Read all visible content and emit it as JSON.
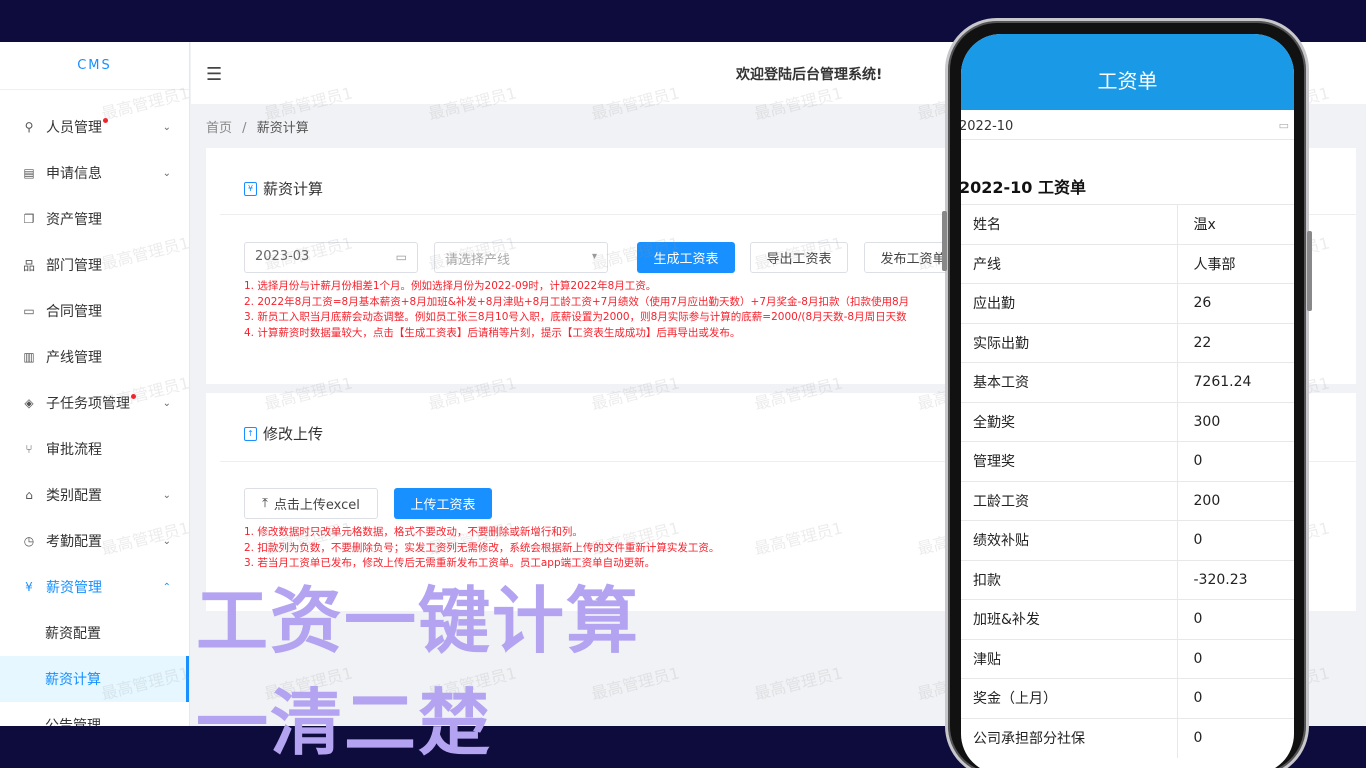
{
  "app": {
    "logo": "CMS",
    "welcome": "欢迎登陆后台管理系统!",
    "watermark": "最高管理员1"
  },
  "sidebar": {
    "items": [
      {
        "label": "人员管理",
        "icon": "user-icon",
        "glyph": "⚲",
        "dot": true,
        "chevron": "﹀"
      },
      {
        "label": "申请信息",
        "icon": "document-icon",
        "glyph": "▤",
        "dot": false,
        "chevron": "﹀"
      },
      {
        "label": "资产管理",
        "icon": "copy-icon",
        "glyph": "❐",
        "dot": false,
        "chevron": ""
      },
      {
        "label": "部门管理",
        "icon": "org-chart-icon",
        "glyph": "品",
        "dot": false,
        "chevron": ""
      },
      {
        "label": "合同管理",
        "icon": "folder-icon",
        "glyph": "▭",
        "dot": false,
        "chevron": ""
      },
      {
        "label": "产线管理",
        "icon": "pillar-icon",
        "glyph": "▥",
        "dot": false,
        "chevron": ""
      },
      {
        "label": "子任务项管理",
        "icon": "tag-icon",
        "glyph": "◈",
        "dot": true,
        "chevron": "﹀"
      },
      {
        "label": "审批流程",
        "icon": "branch-icon",
        "glyph": "⑂",
        "dot": false,
        "chevron": ""
      },
      {
        "label": "类别配置",
        "icon": "bank-icon",
        "glyph": "⌂",
        "dot": false,
        "chevron": "﹀"
      },
      {
        "label": "考勤配置",
        "icon": "clock-icon",
        "glyph": "◷",
        "dot": false,
        "chevron": "﹀"
      },
      {
        "label": "薪资管理",
        "icon": "yen-icon",
        "glyph": "¥",
        "dot": false,
        "chevron": "︿"
      }
    ],
    "sub_items": [
      "薪资配置",
      "薪资计算"
    ],
    "last_item": "公告管理"
  },
  "breadcrumb": {
    "home": "首页",
    "sep": "/",
    "current": "薪资计算"
  },
  "calc_card": {
    "title": "薪资计算",
    "date_value": "2023-03",
    "line_placeholder": "请选择产线",
    "generate_btn": "生成工资表",
    "export_btn": "导出工资表",
    "publish_btn": "发布工资单",
    "notes": [
      "1. 选择月份与计薪月份相差1个月。例如选择月份为2022-09时，计算2022年8月工资。",
      "2. 2022年8月工资=8月基本薪资+8月加班&补发+8月津贴+8月工龄工资+7月绩效（使用7月应出勤天数）+7月奖金-8月扣款（扣款使用8月",
      "3. 新员工入职当月底薪会动态调整。例如员工张三8月10号入职，底薪设置为2000，则8月实际参与计算的底薪=2000/(8月天数-8月周日天数",
      "4. 计算薪资时数据量较大，点击【生成工资表】后请稍等片刻，提示【工资表生成成功】后再导出或发布。"
    ]
  },
  "upload_card": {
    "title": "修改上传",
    "upload_btn": "点击上传excel",
    "submit_btn": "上传工资表",
    "notes": [
      "1. 修改数据时只改单元格数据，格式不要改动，不要删除或新增行和列。",
      "2. 扣款列为负数，不要删除负号；实发工资列无需修改，系统会根据新上传的文件重新计算实发工资。",
      "3. 若当月工资单已发布，修改上传后无需重新发布工资单。员工app端工资单自动更新。"
    ]
  },
  "promo": {
    "line1": "工资一键计算",
    "line2": "一清二楚"
  },
  "phone": {
    "header": "工资单",
    "date": "2022-10",
    "title": "2022-10 工资单",
    "rows": [
      {
        "k": "姓名",
        "v": "温x"
      },
      {
        "k": "产线",
        "v": "人事部"
      },
      {
        "k": "应出勤",
        "v": "26"
      },
      {
        "k": "实际出勤",
        "v": "22"
      },
      {
        "k": "基本工资",
        "v": "7261.24"
      },
      {
        "k": "全勤奖",
        "v": "300"
      },
      {
        "k": "管理奖",
        "v": "0"
      },
      {
        "k": "工龄工资",
        "v": "200"
      },
      {
        "k": "绩效补贴",
        "v": "0"
      },
      {
        "k": "扣款",
        "v": "-320.23"
      },
      {
        "k": "加班&补发",
        "v": "0"
      },
      {
        "k": "津贴",
        "v": "0"
      },
      {
        "k": "奖金（上月）",
        "v": "0"
      },
      {
        "k": "公司承担部分社保",
        "v": "0"
      }
    ]
  }
}
